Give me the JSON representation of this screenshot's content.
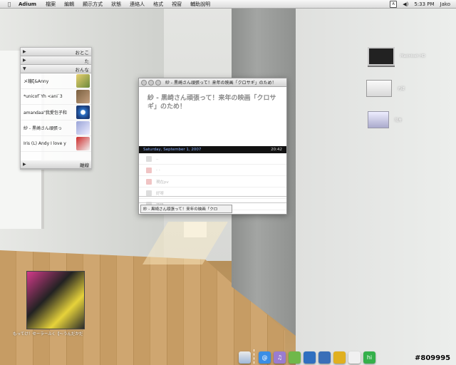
{
  "menubar": {
    "app": "Adium",
    "items": [
      "檔案",
      "編輯",
      "顯示方式",
      "狀態",
      "連絡人",
      "格式",
      "視窗",
      "輔助說明"
    ],
    "time": "5:33 PM",
    "user": "Jako",
    "icons": [
      "apple-icon",
      "input-method-icon",
      "volume-icon"
    ]
  },
  "contacts": {
    "groups": [
      {
        "label": "おとこ",
        "expanded": false
      },
      {
        "label": "た",
        "expanded": false
      },
      {
        "label": "おんな",
        "expanded": true
      }
    ],
    "items": [
      {
        "name": "メ鐘ξ&Anny"
      },
      {
        "name": "*unicof`Yh <ani`3"
      },
      {
        "name": "amandaa\"我愛包子和"
      },
      {
        "name": "紗 - 黒崎さん頑張っ"
      },
      {
        "name": "Iris (L) Andy  I love y"
      }
    ],
    "bottom_group": "離線"
  },
  "chat": {
    "title": "紗 - 黒崎さん頑張って！来年の映画「クロサギ」のため！",
    "header_text": "紗 - 黒崎さん頑張って！来年の映画「クロサギ」のため！",
    "date": "Saturday, September 1, 2007",
    "time": "20:42",
    "messages": [
      "..",
      "- -",
      "現在pv",
      "好呀",
      "我係"
    ],
    "tab_label": "紗 - 黒崎さん頑張って！来年の映画「クロ"
  },
  "desktop_icons": [
    {
      "label": "Macintosh HD",
      "icon": "hard-disk-icon"
    },
    {
      "label": "光碟",
      "icon": "dvd-icon"
    },
    {
      "label": "隨身",
      "icon": "usb-drive-icon"
    }
  ],
  "album": {
    "caption": "もってけ！セーラーふく【～うんだかだ"
  },
  "dock": {
    "items": [
      "finder-icon",
      "mail-icon",
      "itunes-icon",
      "preview-icon",
      "xcode-icon",
      "dashboard-icon",
      "safari-icon",
      "adium-icon",
      "ichat-icon"
    ]
  },
  "watermark": "#809995"
}
